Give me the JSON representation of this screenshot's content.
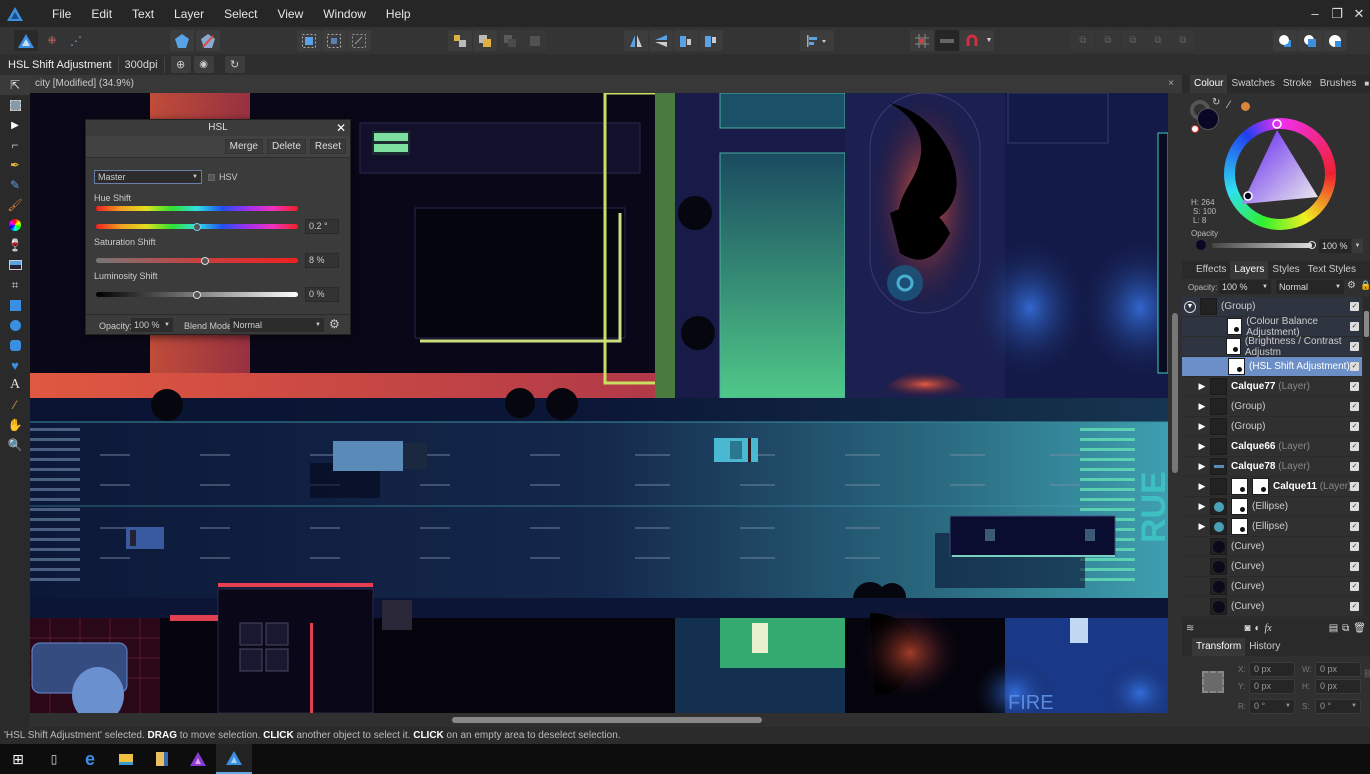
{
  "app": {
    "menu": [
      "File",
      "Edit",
      "Text",
      "Layer",
      "Select",
      "View",
      "Window",
      "Help"
    ],
    "window_controls": {
      "minimize": "–",
      "restore": "❐",
      "close": "✕"
    }
  },
  "context_bar": {
    "tool_name": "HSL Shift Adjustment",
    "dpi": "300dpi"
  },
  "document": {
    "tab_title": "city [Modified] (34.9%)",
    "close": "×"
  },
  "hsl_dialog": {
    "title": "HSL",
    "buttons": {
      "merge": "Merge",
      "delete": "Delete",
      "reset": "Reset"
    },
    "channel": "Master",
    "hsv_label": "HSV",
    "hsv_checked": false,
    "hue_label": "Hue Shift",
    "hue_value": "0.2 °",
    "hue_fraction": 0.5,
    "saturation_label": "Saturation Shift",
    "saturation_value": "8 %",
    "saturation_fraction": 0.54,
    "luminosity_label": "Luminosity Shift",
    "luminosity_value": "0 %",
    "luminosity_fraction": 0.5,
    "opacity_label": "Opacity:",
    "opacity_value": "100 %",
    "blend_label": "Blend Mode:",
    "blend_value": "Normal"
  },
  "colour_panel": {
    "tabs": [
      "Colour",
      "Swatches",
      "Stroke",
      "Brushes"
    ],
    "active_tab": "Colour",
    "h": "H: 264",
    "s": "S: 100",
    "l": "L: 8",
    "opacity_label": "Opacity",
    "opacity_value": "100 %",
    "primary_color": "#0a0626",
    "accent_color": "#d9863c"
  },
  "layers_panel": {
    "tabs": [
      "Effects",
      "Layers",
      "Styles",
      "Text Styles"
    ],
    "active_tab": "Layers",
    "opacity_label": "Opacity:",
    "opacity_value": "100 %",
    "blend_value": "Normal",
    "layers": [
      {
        "name": "(Group)",
        "type": "",
        "expanded": true,
        "indent": 0,
        "thumbs": 1
      },
      {
        "name": "(Colour Balance Adjustment)",
        "type": "",
        "indent": 1,
        "thumbs": 1,
        "white": true
      },
      {
        "name": "(Brightness / Contrast Adjustm",
        "type": "",
        "indent": 1,
        "thumbs": 1,
        "white": true
      },
      {
        "name": "(HSL Shift Adjustment)",
        "type": "",
        "indent": 1,
        "thumbs": 1,
        "white": true,
        "selected": true
      },
      {
        "name": "Calque77",
        "type": "(Layer)",
        "bold": true,
        "arrow": true,
        "thumbs": 1
      },
      {
        "name": "(Group)",
        "type": "",
        "arrow": true,
        "thumbs": 1
      },
      {
        "name": "(Group)",
        "type": "",
        "arrow": true,
        "thumbs": 1
      },
      {
        "name": "Calque66",
        "type": "(Layer)",
        "bold": true,
        "arrow": true,
        "thumbs": 1
      },
      {
        "name": "Calque78",
        "type": "(Layer)",
        "bold": true,
        "arrow": true,
        "thumbs": 1
      },
      {
        "name": "Calque11",
        "type": "(Layer)",
        "bold": true,
        "arrow": true,
        "thumbs": 3
      },
      {
        "name": "(Ellipse)",
        "type": "",
        "arrow": true,
        "thumbs": 2
      },
      {
        "name": "(Ellipse)",
        "type": "",
        "arrow": true,
        "thumbs": 2
      },
      {
        "name": "(Curve)",
        "type": "",
        "thumbs": 1
      },
      {
        "name": "(Curve)",
        "type": "",
        "thumbs": 1
      },
      {
        "name": "(Curve)",
        "type": "",
        "thumbs": 1
      },
      {
        "name": "(Curve)",
        "type": "",
        "thumbs": 1
      }
    ]
  },
  "transform_panel": {
    "tabs": [
      "Transform",
      "History"
    ],
    "active_tab": "Transform",
    "x_label": "X:",
    "x": "0 px",
    "y_label": "Y:",
    "y": "0 px",
    "w_label": "W:",
    "w": "0 px",
    "h_label": "H:",
    "h": "0 px",
    "r_label": "R:",
    "r": "0 °",
    "s_label": "S:",
    "s": "0 °"
  },
  "canvas_text": {
    "sign": "FIRE"
  },
  "status": {
    "p1": "'HSL Shift Adjustment' selected. ",
    "b1": "DRAG",
    "p2": " to move selection. ",
    "b2": "CLICK",
    "p3": " another object to select it. ",
    "b3": "CLICK",
    "p4": " on an empty area to deselect selection."
  }
}
